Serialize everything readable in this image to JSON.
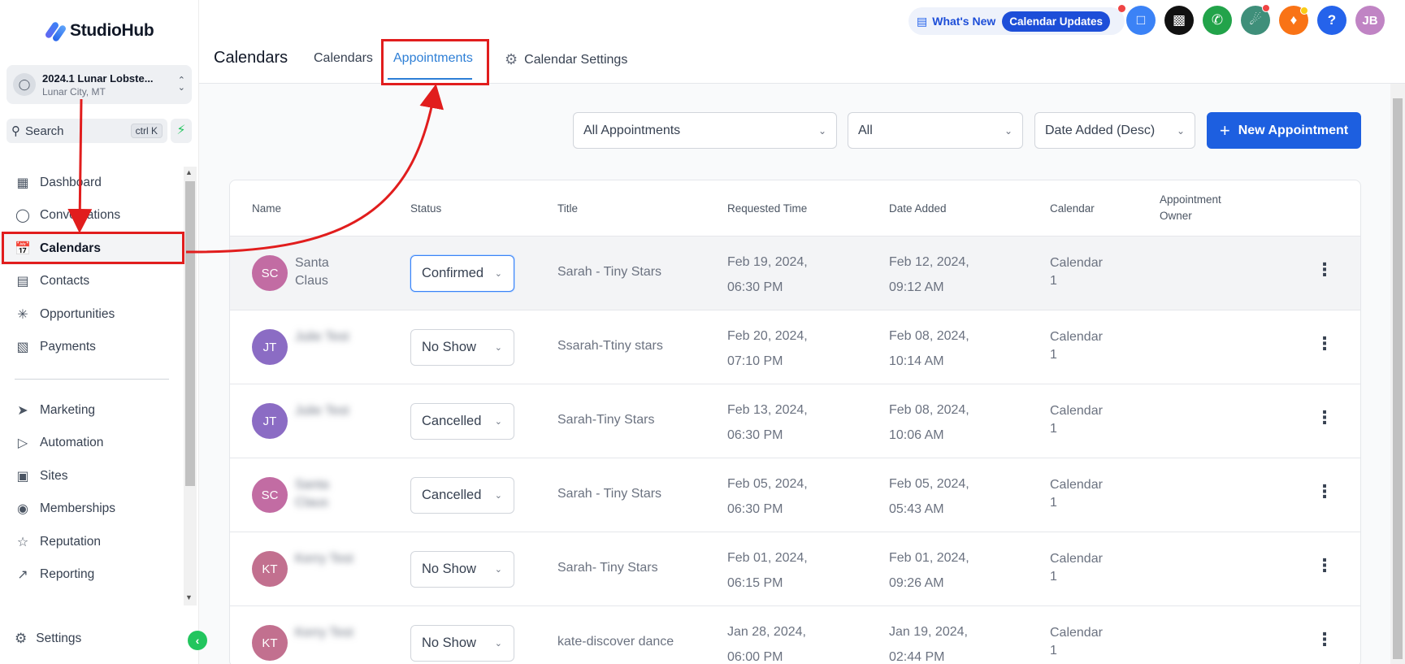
{
  "brand": {
    "name": "StudioHub"
  },
  "account": {
    "name": "2024.1 Lunar Lobste...",
    "location": "Lunar City, MT"
  },
  "search": {
    "label": "Search",
    "shortcut": "ctrl K"
  },
  "sidebar": {
    "items": [
      {
        "label": "Dashboard",
        "icon": "dashboard-icon"
      },
      {
        "label": "Conversations",
        "icon": "chat-icon"
      },
      {
        "label": "Calendars",
        "icon": "calendar-icon"
      },
      {
        "label": "Contacts",
        "icon": "contacts-icon"
      },
      {
        "label": "Opportunities",
        "icon": "opportunities-icon"
      },
      {
        "label": "Payments",
        "icon": "payments-icon"
      },
      {
        "label": "Marketing",
        "icon": "send-icon"
      },
      {
        "label": "Automation",
        "icon": "automation-icon"
      },
      {
        "label": "Sites",
        "icon": "sites-icon"
      },
      {
        "label": "Memberships",
        "icon": "membership-icon"
      },
      {
        "label": "Reputation",
        "icon": "star-icon"
      },
      {
        "label": "Reporting",
        "icon": "chart-icon"
      }
    ],
    "settings_label": "Settings"
  },
  "header": {
    "title": "Calendars",
    "tabs": [
      {
        "label": "Calendars"
      },
      {
        "label": "Appointments"
      },
      {
        "label": "Calendar Settings"
      }
    ],
    "whats_new": "What's New",
    "calendar_updates": "Calendar Updates",
    "user_initials": "JB",
    "help_label": "?"
  },
  "filters": {
    "type": "All Appointments",
    "status": "All",
    "sort": "Date Added (Desc)",
    "new_button": "New Appointment"
  },
  "table": {
    "columns": [
      "Name",
      "Status",
      "Title",
      "Requested Time",
      "Date Added",
      "Calendar",
      "Appointment Owner"
    ],
    "rows": [
      {
        "initials": "SC",
        "name": "Santa Claus",
        "status": "Confirmed",
        "title": "Sarah - Tiny Stars",
        "req_date": "Feb 19, 2024,",
        "req_time": "06:30 PM",
        "add_date": "Feb 12, 2024,",
        "add_time": "09:12 AM",
        "calendar": "Calendar 1",
        "owner": ""
      },
      {
        "initials": "JT",
        "name": "Julie Test",
        "status": "No Show",
        "title": "Ssarah-Ttiny stars",
        "req_date": "Feb 20, 2024,",
        "req_time": "07:10 PM",
        "add_date": "Feb 08, 2024,",
        "add_time": "10:14 AM",
        "calendar": "Calendar 1",
        "owner": ""
      },
      {
        "initials": "JT",
        "name": "Julie Test",
        "status": "Cancelled",
        "title": "Sarah-Tiny Stars",
        "req_date": "Feb 13, 2024,",
        "req_time": "06:30 PM",
        "add_date": "Feb 08, 2024,",
        "add_time": "10:06 AM",
        "calendar": "Calendar 1",
        "owner": ""
      },
      {
        "initials": "SC",
        "name": "Santa Claus",
        "status": "Cancelled",
        "title": "Sarah - Tiny Stars",
        "req_date": "Feb 05, 2024,",
        "req_time": "06:30 PM",
        "add_date": "Feb 05, 2024,",
        "add_time": "05:43 AM",
        "calendar": "Calendar 1",
        "owner": ""
      },
      {
        "initials": "KT",
        "name": "Kerry Test",
        "status": "No Show",
        "title": "Sarah- Tiny Stars",
        "req_date": "Feb 01, 2024,",
        "req_time": "06:15 PM",
        "add_date": "Feb 01, 2024,",
        "add_time": "09:26 AM",
        "calendar": "Calendar 1",
        "owner": ""
      },
      {
        "initials": "KT",
        "name": "Kerry Test",
        "status": "No Show",
        "title": "kate-discover dance",
        "req_date": "Jan 28, 2024,",
        "req_time": "06:00 PM",
        "add_date": "Jan 19, 2024,",
        "add_time": "02:44 PM",
        "calendar": "Calendar 1",
        "owner": ""
      }
    ]
  },
  "colors": {
    "accent": "#1d5fe0",
    "annotation": "#e11d1d",
    "avatar_sc": "#c26ca3",
    "avatar_jt": "#8b6cc4",
    "avatar_kt": "#c2708f"
  }
}
